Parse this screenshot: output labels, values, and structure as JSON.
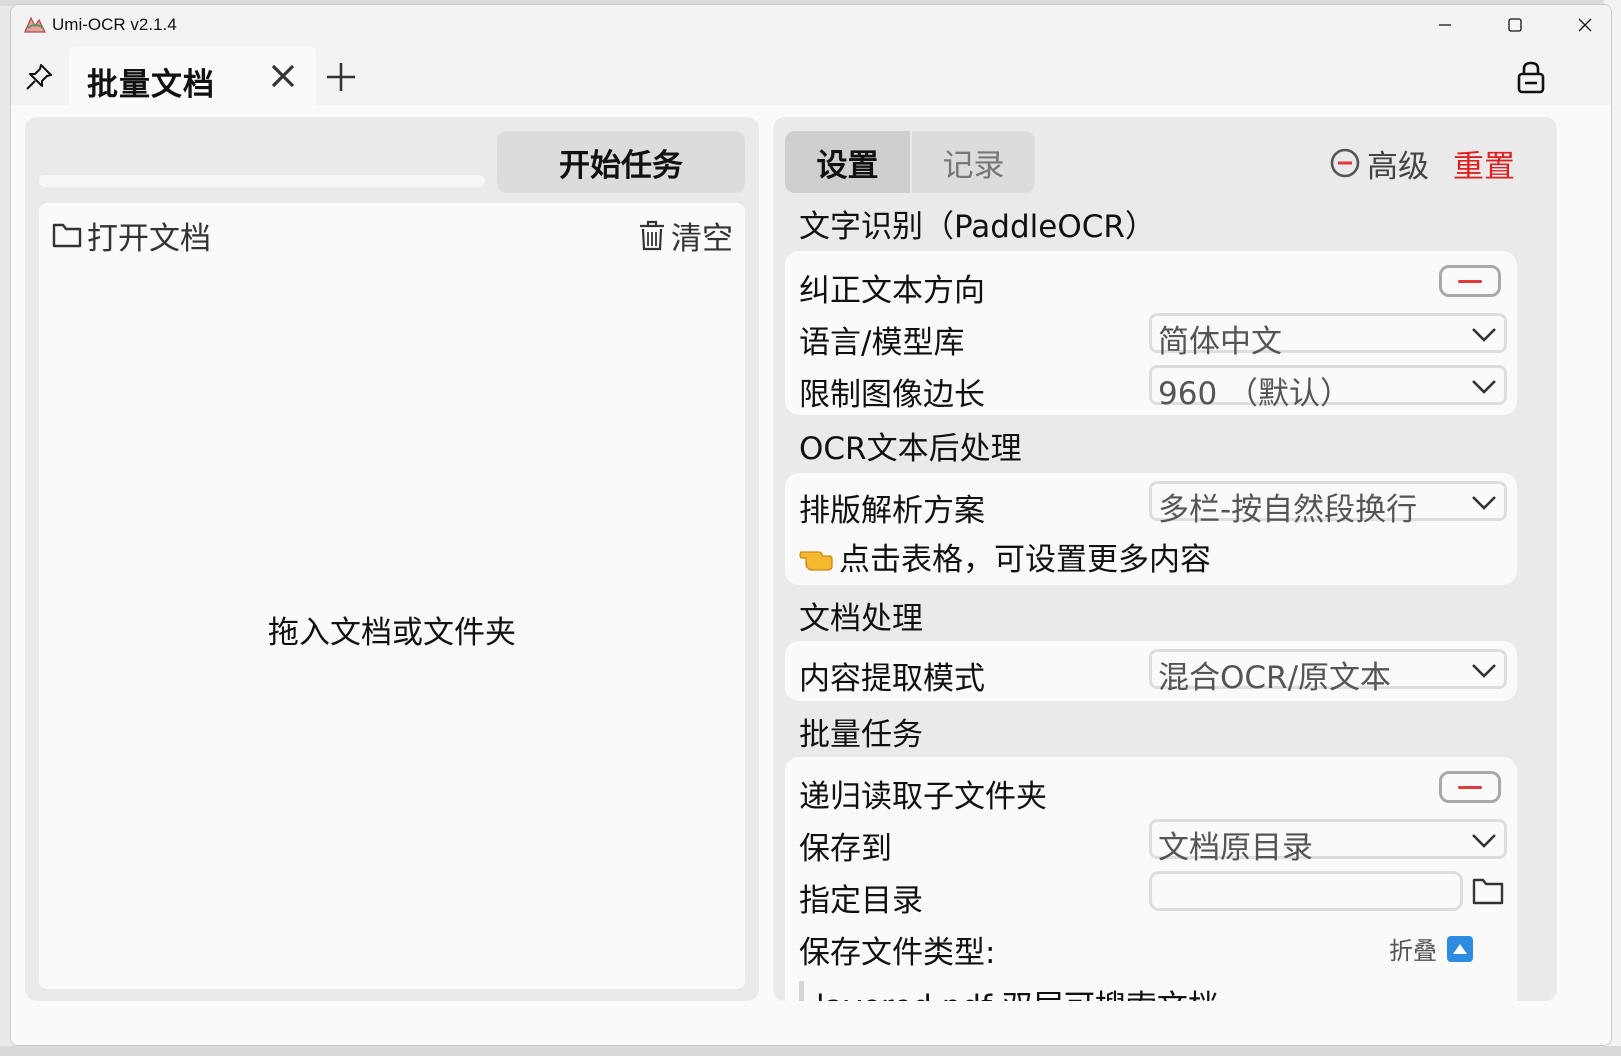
{
  "window": {
    "title": "Umi-OCR v2.1.4"
  },
  "tabbar": {
    "active_tab": "批量文档"
  },
  "left": {
    "start_button": "开始任务",
    "open_doc": "打开文档",
    "clear": "清空",
    "drop_hint": "拖入文档或文件夹",
    "progress": 0
  },
  "right": {
    "tabs": [
      "设置",
      "记录"
    ],
    "advanced": "高级",
    "reset": "重置",
    "sections": {
      "ocr": {
        "title": "文字识别（PaddleOCR）",
        "rows": {
          "correct_direction": {
            "label": "纠正文本方向",
            "value": false
          },
          "language": {
            "label": "语言/模型库",
            "value": "简体中文"
          },
          "limit_side": {
            "label": "限制图像边长",
            "value": "960 （默认）"
          }
        }
      },
      "postprocess": {
        "title": "OCR文本后处理",
        "layout": {
          "label": "排版解析方案",
          "value": "多栏-按自然段换行"
        },
        "tip": "点击表格，可设置更多内容"
      },
      "doc": {
        "title": "文档处理",
        "extract": {
          "label": "内容提取模式",
          "value": "混合OCR/原文本"
        }
      },
      "batch": {
        "title": "批量任务",
        "recursive": {
          "label": "递归读取子文件夹",
          "value": false
        },
        "save_to": {
          "label": "保存到",
          "value": "文档原目录"
        },
        "custom_dir": {
          "label": "指定目录",
          "value": ""
        },
        "file_types": {
          "label": "保存文件类型:",
          "collapse": "折叠"
        },
        "layered_pdf": {
          "label": "layered.pdf 双层可搜索文档",
          "value": true
        }
      }
    }
  },
  "colors": {
    "accent_red": "#e02020",
    "toggle_on": "#19c23a",
    "collapse_blue": "#2d8be0"
  }
}
